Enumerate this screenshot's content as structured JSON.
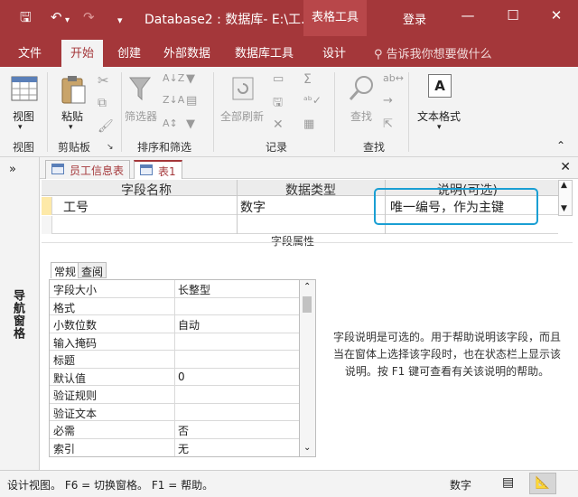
{
  "titlebar": {
    "doc_title": "Database2 : 数据库- E:\\工...",
    "tool_tab": "表格工具",
    "login": "登录",
    "minimize": "—",
    "restore": "☐",
    "close": "✕"
  },
  "ribbon_tabs": {
    "file": "文件",
    "home": "开始",
    "create": "创建",
    "external": "外部数据",
    "dbtools": "数据库工具",
    "design": "设计",
    "tellme": "告诉我你想要做什么"
  },
  "ribbon": {
    "view_btn": "视图",
    "paste_btn": "粘贴",
    "filter_btn": "筛选器",
    "refresh_btn": "全部刷新",
    "find_btn": "查找",
    "textformat_btn": "文本格式",
    "groups": {
      "view": "视图",
      "clipboard": "剪贴板",
      "sortfilter": "排序和筛选",
      "records": "记录",
      "find": "查找"
    }
  },
  "navpane": {
    "label": "导航窗格",
    "toggle": "»"
  },
  "doc_tabs": [
    {
      "label": "员工信息表"
    },
    {
      "label": "表1"
    }
  ],
  "design_grid": {
    "headers": {
      "name": "字段名称",
      "type": "数据类型",
      "desc": "说明(可选)"
    },
    "rows": [
      {
        "name": "工号",
        "type": "数字",
        "desc": "唯一编号，作为主键"
      }
    ]
  },
  "field_props": {
    "title": "字段属性",
    "tabs": {
      "general": "常规",
      "lookup": "查阅"
    },
    "rows": [
      {
        "key": "字段大小",
        "value": "长整型"
      },
      {
        "key": "格式",
        "value": ""
      },
      {
        "key": "小数位数",
        "value": "自动"
      },
      {
        "key": "输入掩码",
        "value": ""
      },
      {
        "key": "标题",
        "value": ""
      },
      {
        "key": "默认值",
        "value": "0"
      },
      {
        "key": "验证规则",
        "value": ""
      },
      {
        "key": "验证文本",
        "value": ""
      },
      {
        "key": "必需",
        "value": "否"
      },
      {
        "key": "索引",
        "value": "无"
      }
    ],
    "help": "字段说明是可选的。用于帮助说明该字段，而且当在窗体上选择该字段时，也在状态栏上显示该说明。按 F1 键可查看有关该说明的帮助。"
  },
  "status": {
    "left": "设计视图。  F6 = 切换窗格。  F1 = 帮助。",
    "numlock": "数字"
  },
  "colors": {
    "accent": "#a4373a",
    "highlight": "#1a9fd3"
  }
}
